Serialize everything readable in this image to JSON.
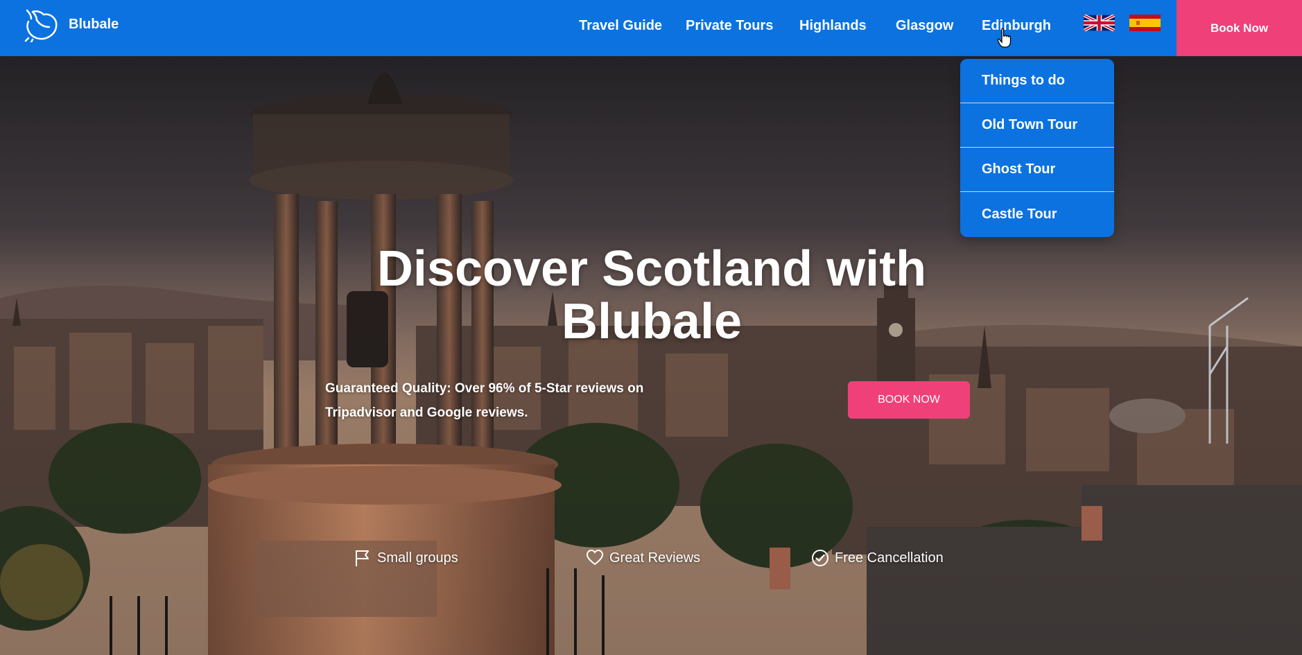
{
  "brand": {
    "name": "Blubale",
    "logo_icon": "dolphin-logo-icon"
  },
  "nav": {
    "items": [
      {
        "label": "Travel Guide"
      },
      {
        "label": "Private Tours"
      },
      {
        "label": "Highlands"
      },
      {
        "label": "Glasgow"
      },
      {
        "label": "Edinburgh"
      }
    ],
    "languages": [
      {
        "icon": "uk-flag-icon"
      },
      {
        "icon": "spain-flag-icon"
      }
    ],
    "book_now": "Book Now"
  },
  "dropdown": {
    "parent": "Edinburgh",
    "items": [
      {
        "label": "Things to do"
      },
      {
        "label": "Old Town Tour"
      },
      {
        "label": "Ghost Tour"
      },
      {
        "label": "Castle Tour"
      }
    ]
  },
  "hero": {
    "title": "Discover Scotland with Blubale",
    "subtitle": "Guaranteed Quality: Over 96% of 5-Star reviews on Tripadvisor and Google reviews.",
    "cta": "BOOK NOW",
    "features": [
      {
        "icon": "flag-icon",
        "label": "Small groups"
      },
      {
        "icon": "heart-icon",
        "label": "Great Reviews"
      },
      {
        "icon": "check-circle-icon",
        "label": "Free Cancellation"
      }
    ]
  },
  "colors": {
    "header": "#0b72e0",
    "accent": "#f0407a",
    "text": "#ffffff"
  }
}
